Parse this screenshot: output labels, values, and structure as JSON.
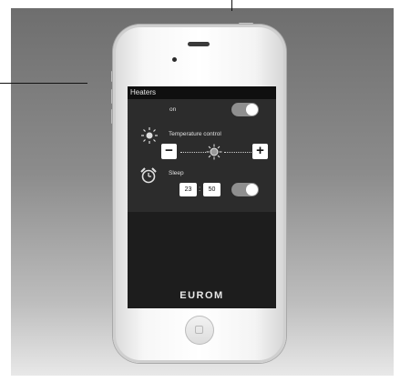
{
  "app": {
    "title": "Heaters",
    "brand": "EUROM"
  },
  "power": {
    "label": "on",
    "state": true
  },
  "temperature": {
    "label": "Temperature control",
    "decrease_symbol": "−",
    "increase_symbol": "+",
    "icon": "sun-icon"
  },
  "sleep": {
    "label": "Sleep",
    "hours": "23",
    "minutes": "50",
    "separator": ":",
    "state": true,
    "icon": "alarm-clock-icon"
  },
  "colors": {
    "screen_bg": "#1d1d1d",
    "panel_bg": "#2c2c2c",
    "toggle_track": "#8f8f8f"
  }
}
